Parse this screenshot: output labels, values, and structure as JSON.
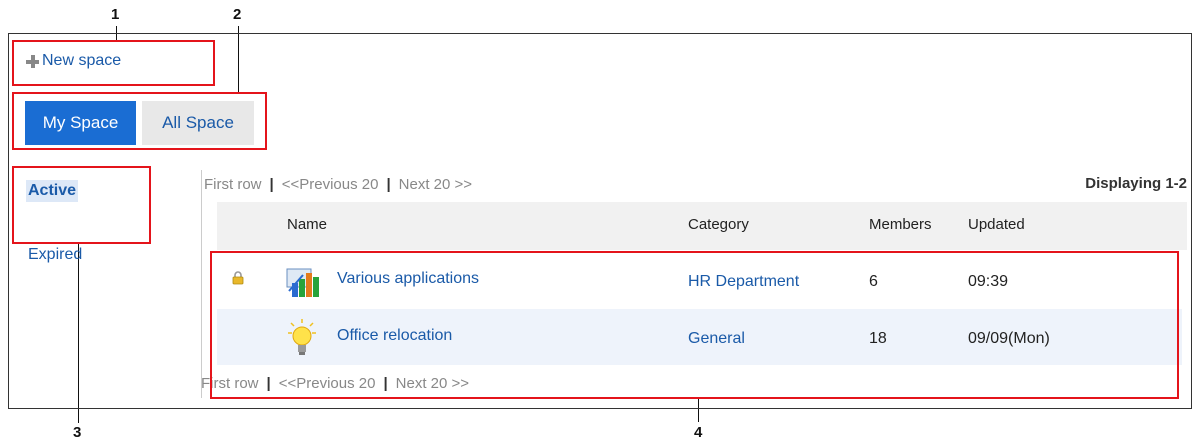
{
  "callouts": {
    "n1": "1",
    "n2": "2",
    "n3": "3",
    "n4": "4"
  },
  "toolbar": {
    "new_space": "New space"
  },
  "tabs": [
    {
      "label": "My Space"
    },
    {
      "label": "All Space"
    }
  ],
  "sidebar": {
    "items": [
      {
        "label": "Active"
      },
      {
        "label": "Expired"
      }
    ]
  },
  "pager": {
    "first": "First row",
    "prev": "<<Previous 20",
    "next": "Next 20 >>",
    "sep": "|"
  },
  "displaying": "Displaying 1-2",
  "table": {
    "headers": [
      "Name",
      "Category",
      "Members",
      "Updated"
    ],
    "rows": [
      {
        "name": "Various applications",
        "category": "HR Department",
        "members": "6",
        "updated": "09:39",
        "icon": "app-icon",
        "locked": true
      },
      {
        "name": "Office relocation",
        "category": "General",
        "members": "18",
        "updated": "09/09(Mon)",
        "icon": "bulb-icon",
        "locked": false
      }
    ]
  },
  "colors": {
    "accent": "#1a6dd3",
    "link": "#1a5aa8",
    "highlight": "#e4141b"
  }
}
